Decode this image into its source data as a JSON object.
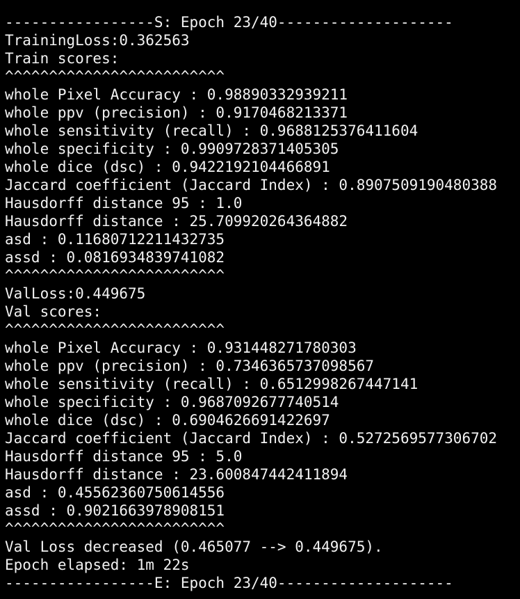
{
  "terminal": {
    "background": "#000000",
    "foreground": "#f2f2f2",
    "lines": [
      "-----------------S: Epoch 23/40--------------------",
      "TrainingLoss:0.362563",
      "Train scores:",
      "^^^^^^^^^^^^^^^^^^^^^^^^^",
      "whole Pixel Accuracy : 0.98890332939211",
      "whole ppv (precision) : 0.9170468213371",
      "whole sensitivity (recall) : 0.9688125376411604",
      "whole specificity : 0.9909728371405305",
      "whole dice (dsc) : 0.9422192104466891",
      "Jaccard coefficient (Jaccard Index) : 0.8907509190480388",
      "Hausdorff distance 95 : 1.0",
      "Hausdorff distance : 25.709920264364882",
      "asd : 0.11680712211432735",
      "assd : 0.0816934839741082",
      "^^^^^^^^^^^^^^^^^^^^^^^^^",
      "ValLoss:0.449675",
      "Val scores:",
      "^^^^^^^^^^^^^^^^^^^^^^^^^",
      "whole Pixel Accuracy : 0.931448271780303",
      "whole ppv (precision) : 0.7346365737098567",
      "whole sensitivity (recall) : 0.6512998267447141",
      "whole specificity : 0.9687092677740514",
      "whole dice (dsc) : 0.6904626691422697",
      "Jaccard coefficient (Jaccard Index) : 0.5272569577306702",
      "Hausdorff distance 95 : 5.0",
      "Hausdorff distance : 23.600847442411894",
      "asd : 0.4556236075061455​6",
      "assd : 0.9021663978908151",
      "^^^^^^^^^^^^^^^^^^^^^^^^^",
      "Val Loss decreased (0.465077 --> 0.449675).",
      "Epoch elapsed: 1m 22s",
      "-----------------E: Epoch 23/40--------------------"
    ]
  }
}
